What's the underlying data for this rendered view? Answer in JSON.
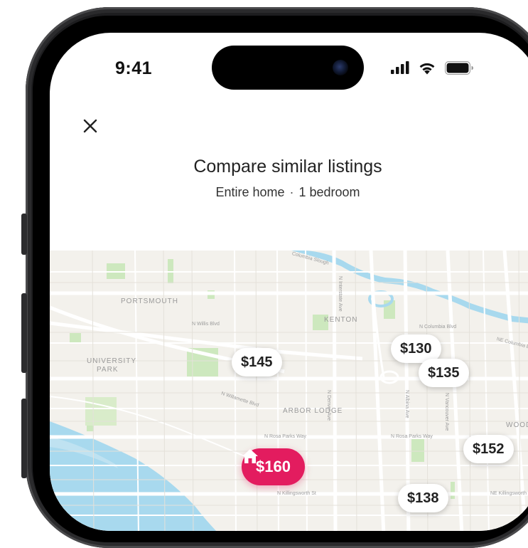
{
  "status_bar": {
    "time": "9:41",
    "icons": [
      "cellular-signal-icon",
      "wifi-icon",
      "battery-icon"
    ]
  },
  "header": {
    "close_icon": "close-icon",
    "title": "Compare similar listings",
    "subtitle_property_type": "Entire home",
    "subtitle_separator": "·",
    "subtitle_bedrooms": "1 bedroom"
  },
  "map": {
    "neighborhood_labels": [
      "PORTSMOUTH",
      "KENTON",
      "UNIVERSITY",
      "PARK",
      "ARBOR LODGE",
      "WOODLAW"
    ],
    "street_labels": [
      "Columbia Slough",
      "N Columbia Blvd",
      "N Willis Blvd",
      "N Rosa Parks Way",
      "N Rosa Parks Way",
      "N Willamette Blvd",
      "N Killingsworth St",
      "NE Killingsworth",
      "N Denver Ave",
      "N Albina Ave",
      "N Vancouver Ave",
      "N Interstate Ave",
      "NE Columbia Blvd"
    ],
    "price_pins": [
      {
        "label": "$145",
        "active": false
      },
      {
        "label": "$130",
        "active": false
      },
      {
        "label": "$135",
        "active": false
      },
      {
        "label": "$152",
        "active": false
      },
      {
        "label": "$160",
        "active": true,
        "icon": "home-icon"
      },
      {
        "label": "$138",
        "active": false
      }
    ]
  },
  "colors": {
    "accent": "#e31c5f",
    "map_background": "#f3f1ec",
    "water": "#a8d9ee",
    "park": "#cde8be"
  }
}
